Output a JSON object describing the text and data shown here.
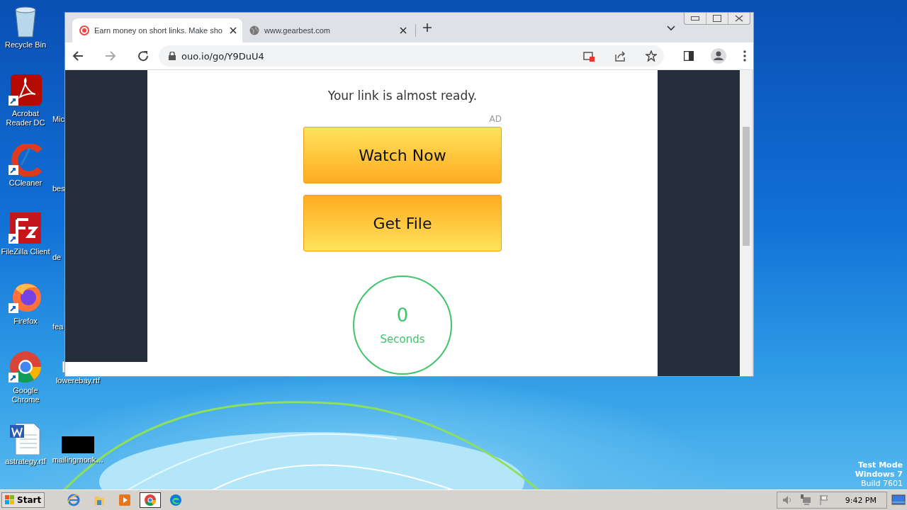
{
  "desktop": {
    "icons": [
      {
        "label": "Recycle Bin",
        "kind": "bin"
      },
      {
        "label": "Acrobat Reader DC",
        "kind": "pdf"
      },
      {
        "label": "CCleaner",
        "kind": "ccleaner"
      },
      {
        "label": "FileZilla Client",
        "kind": "filezilla"
      },
      {
        "label": "Firefox",
        "kind": "firefox"
      },
      {
        "label": "Google Chrome",
        "kind": "chrome"
      },
      {
        "label": "astrategy.rtf",
        "kind": "word"
      },
      {
        "label": "Mic",
        "kind": "hidden"
      },
      {
        "label": "bes",
        "kind": "hidden"
      },
      {
        "label": "de",
        "kind": "hidden"
      },
      {
        "label": "fea",
        "kind": "hidden"
      },
      {
        "label": "lowerebay.rtf",
        "kind": "doc"
      },
      {
        "label": "mailingmonk…",
        "kind": "thumb"
      }
    ],
    "notice": [
      "Test Mode",
      "Windows 7",
      "Build 7601"
    ]
  },
  "browser": {
    "tabs": [
      {
        "title": "Earn money on short links. Make sho",
        "kind": "target",
        "selected": true
      },
      {
        "title": "www.gearbest.com",
        "kind": "globe",
        "selected": false
      }
    ],
    "url": "ouo.io/go/Y9DuU4",
    "page": {
      "heading": "Your link is almost ready.",
      "ad_label": "AD",
      "buttons": [
        {
          "label": "Watch Now",
          "kind": "down"
        },
        {
          "label": "Get File",
          "kind": "up"
        }
      ],
      "countdown": {
        "value": "0",
        "unit": "Seconds"
      }
    }
  },
  "taskbar": {
    "start": "Start",
    "apps": [
      {
        "kind": "ie",
        "selected": false
      },
      {
        "kind": "folder",
        "selected": false
      },
      {
        "kind": "media",
        "selected": false
      },
      {
        "kind": "chrome",
        "selected": true
      },
      {
        "kind": "edge",
        "selected": false
      }
    ],
    "clock": "9:42 PM"
  }
}
